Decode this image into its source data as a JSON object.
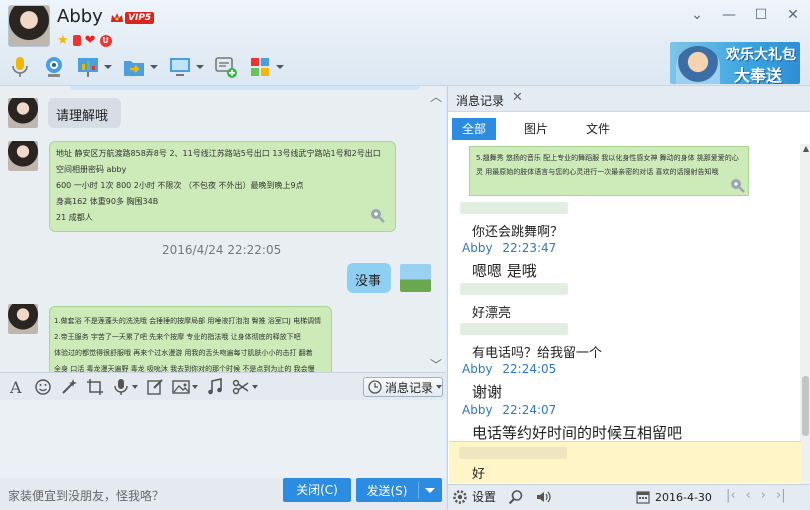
{
  "header": {
    "contact_name": "Abby",
    "vip_label": "VIP5",
    "promo_line1": "欢乐大礼包",
    "promo_line2": "大奉送",
    "status_u": "U"
  },
  "chat": {
    "messages": [
      {
        "side": "left",
        "text": "请理解哦"
      },
      {
        "side": "left",
        "lines": [
          "地址  静安区万航渡路858弄8号  2、11号线江苏路站5号出口    13号线武宁路站1号和2号出口",
          "空间相册密码  abby",
          "600  一小时 1次     800  2小时 不限次   （不包夜 不外出）最晚到晚上9点",
          "身高162  体重90多   胸围34B",
          "21  成都人"
        ]
      },
      {
        "side": "right",
        "text": "没事"
      },
      {
        "side": "left",
        "lines": [
          "1.做套浴  不是莲蓬头的洗洗哦  会捶捶的按摩局部  用唾液打泡泡  臀推  浴室口J  电梯调情",
          "2.帝王服务  宇苦了一天累了吧  先来个按摩  专业的指法哦   让身体彻底的释放下吧",
          "体验过的都觉得很舒服哦  再来个过水漫游  用我的舌头吻遍每寸肌肤小小的击打   翻着",
          "全身  口活  毒龙漫天遍野   毒龙  吸吮沐  我去到你对的那个时候  不是点到为止的   我会慢"
        ]
      }
    ],
    "timestamp": "2016/4/24 22:22:05",
    "msglog_label": "消息记录",
    "hint": "家装便宜到没朋友，怪我咯？",
    "close_label": "关闭(C)",
    "send_label": "发送(S)"
  },
  "history": {
    "tab_title": "消息记录",
    "filters": [
      "全部",
      "图片",
      "文件"
    ],
    "snippet": [
      "5.翘舞秀  悠扬的音乐  配上专业的舞蹈服  我以化身性感女神  舞动的身体  挑那爱爱的心",
      "灵  用最原始的肢体语言与您的心灵进行一次最亲密的对话  喜欢的话搜射告知哦"
    ],
    "entries": [
      {
        "name": "",
        "text": "你还会跳舞啊？"
      },
      {
        "name": "Abby",
        "time": "22:23:47",
        "text": "嗯嗯 是哦"
      },
      {
        "name": "",
        "text": "好漂亮"
      },
      {
        "name": "",
        "text": "有电话吗？给我留一个"
      },
      {
        "name": "Abby",
        "time": "22:24:05",
        "text": "谢谢"
      },
      {
        "name": "Abby",
        "time": "22:24:07",
        "text": "电话等约好时间的时候互相留吧"
      },
      {
        "name": "",
        "text": "好"
      }
    ],
    "settings_label": "设置",
    "date": "2016-4-30"
  },
  "colors": {
    "accent": "#2b8ce2",
    "bubble_green": "#cdeab9",
    "bubble_blue": "#8fcff2",
    "name_blue": "#2b78c8"
  }
}
